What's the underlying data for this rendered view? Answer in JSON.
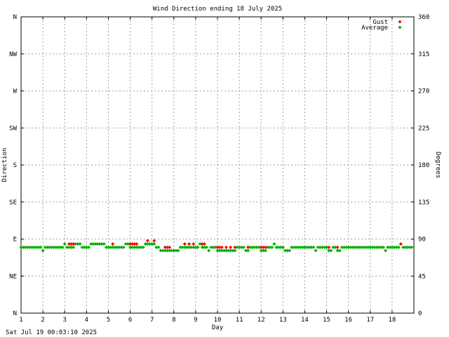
{
  "chart_data": {
    "type": "scatter",
    "title": "Wind Direction ending 18 July 2025",
    "xlabel": "Day",
    "ylabel_left": "Direction",
    "ylabel_right": "Degrees",
    "xlim": [
      1,
      19
    ],
    "ylim": [
      0,
      360
    ],
    "x_ticks": [
      1,
      2,
      3,
      4,
      5,
      6,
      7,
      8,
      9,
      10,
      11,
      12,
      13,
      14,
      15,
      16,
      17,
      18
    ],
    "y_ticks_left": [
      {
        "value": 0,
        "label": "N"
      },
      {
        "value": 45,
        "label": "NE"
      },
      {
        "value": 90,
        "label": "E"
      },
      {
        "value": 135,
        "label": "SE"
      },
      {
        "value": 180,
        "label": "S"
      },
      {
        "value": 225,
        "label": "SW"
      },
      {
        "value": 270,
        "label": "W"
      },
      {
        "value": 315,
        "label": "NW"
      },
      {
        "value": 360,
        "label": "N"
      }
    ],
    "y_ticks_right": [
      0,
      45,
      90,
      135,
      180,
      225,
      270,
      315,
      360
    ],
    "grid": true,
    "legend_position": "top-right",
    "series": [
      {
        "name": "Gust",
        "color": "#ff0000",
        "points": [
          [
            3.2,
            84
          ],
          [
            3.3,
            84
          ],
          [
            3.4,
            84
          ],
          [
            5.2,
            84
          ],
          [
            6.0,
            84
          ],
          [
            6.1,
            84
          ],
          [
            6.2,
            84
          ],
          [
            6.3,
            84
          ],
          [
            6.8,
            88
          ],
          [
            7.1,
            88
          ],
          [
            7.6,
            80
          ],
          [
            7.7,
            80
          ],
          [
            7.8,
            80
          ],
          [
            8.5,
            84
          ],
          [
            8.7,
            84
          ],
          [
            8.9,
            84
          ],
          [
            9.3,
            84
          ],
          [
            9.4,
            84
          ],
          [
            10.0,
            80
          ],
          [
            10.1,
            80
          ],
          [
            10.2,
            80
          ],
          [
            10.4,
            80
          ],
          [
            10.6,
            80
          ],
          [
            10.8,
            80
          ],
          [
            11.4,
            80
          ],
          [
            12.0,
            80
          ],
          [
            12.1,
            80
          ],
          [
            12.2,
            80
          ],
          [
            15.1,
            80
          ],
          [
            15.5,
            80
          ],
          [
            18.4,
            84
          ]
        ]
      },
      {
        "name": "Average",
        "color": "#00b000",
        "points": [
          [
            1.0,
            80
          ],
          [
            1.1,
            80
          ],
          [
            1.2,
            80
          ],
          [
            1.3,
            80
          ],
          [
            1.4,
            80
          ],
          [
            1.5,
            80
          ],
          [
            1.6,
            80
          ],
          [
            1.7,
            80
          ],
          [
            1.8,
            80
          ],
          [
            1.9,
            80
          ],
          [
            2.0,
            76
          ],
          [
            2.1,
            80
          ],
          [
            2.2,
            80
          ],
          [
            2.3,
            80
          ],
          [
            2.4,
            80
          ],
          [
            2.5,
            80
          ],
          [
            2.6,
            80
          ],
          [
            2.7,
            80
          ],
          [
            2.8,
            80
          ],
          [
            2.9,
            80
          ],
          [
            3.0,
            84
          ],
          [
            3.1,
            80
          ],
          [
            3.2,
            80
          ],
          [
            3.3,
            80
          ],
          [
            3.4,
            80
          ],
          [
            3.5,
            84
          ],
          [
            3.6,
            84
          ],
          [
            3.7,
            84
          ],
          [
            3.8,
            80
          ],
          [
            3.9,
            80
          ],
          [
            4.0,
            80
          ],
          [
            4.1,
            80
          ],
          [
            4.2,
            84
          ],
          [
            4.3,
            84
          ],
          [
            4.4,
            84
          ],
          [
            4.5,
            84
          ],
          [
            4.6,
            84
          ],
          [
            4.7,
            84
          ],
          [
            4.8,
            84
          ],
          [
            4.9,
            80
          ],
          [
            5.0,
            80
          ],
          [
            5.1,
            80
          ],
          [
            5.2,
            80
          ],
          [
            5.3,
            80
          ],
          [
            5.4,
            80
          ],
          [
            5.5,
            80
          ],
          [
            5.6,
            80
          ],
          [
            5.7,
            80
          ],
          [
            5.8,
            84
          ],
          [
            5.9,
            84
          ],
          [
            6.0,
            80
          ],
          [
            6.1,
            80
          ],
          [
            6.2,
            80
          ],
          [
            6.3,
            80
          ],
          [
            6.4,
            80
          ],
          [
            6.5,
            80
          ],
          [
            6.6,
            80
          ],
          [
            6.7,
            84
          ],
          [
            6.8,
            84
          ],
          [
            6.9,
            84
          ],
          [
            7.0,
            84
          ],
          [
            7.1,
            84
          ],
          [
            7.2,
            80
          ],
          [
            7.3,
            80
          ],
          [
            7.4,
            76
          ],
          [
            7.5,
            76
          ],
          [
            7.6,
            76
          ],
          [
            7.7,
            76
          ],
          [
            7.8,
            76
          ],
          [
            7.9,
            76
          ],
          [
            8.0,
            76
          ],
          [
            8.1,
            76
          ],
          [
            8.2,
            76
          ],
          [
            8.3,
            80
          ],
          [
            8.4,
            80
          ],
          [
            8.5,
            80
          ],
          [
            8.6,
            80
          ],
          [
            8.7,
            80
          ],
          [
            8.8,
            80
          ],
          [
            8.9,
            80
          ],
          [
            9.0,
            80
          ],
          [
            9.1,
            80
          ],
          [
            9.2,
            84
          ],
          [
            9.3,
            80
          ],
          [
            9.4,
            80
          ],
          [
            9.5,
            80
          ],
          [
            9.6,
            76
          ],
          [
            9.7,
            80
          ],
          [
            9.8,
            80
          ],
          [
            9.9,
            80
          ],
          [
            10.0,
            76
          ],
          [
            10.1,
            76
          ],
          [
            10.2,
            76
          ],
          [
            10.3,
            76
          ],
          [
            10.4,
            76
          ],
          [
            10.5,
            76
          ],
          [
            10.6,
            76
          ],
          [
            10.7,
            76
          ],
          [
            10.8,
            76
          ],
          [
            10.9,
            80
          ],
          [
            11.0,
            80
          ],
          [
            11.1,
            80
          ],
          [
            11.2,
            80
          ],
          [
            11.3,
            76
          ],
          [
            11.4,
            76
          ],
          [
            11.5,
            80
          ],
          [
            11.6,
            80
          ],
          [
            11.7,
            80
          ],
          [
            11.8,
            80
          ],
          [
            11.9,
            80
          ],
          [
            12.0,
            76
          ],
          [
            12.1,
            76
          ],
          [
            12.2,
            76
          ],
          [
            12.3,
            80
          ],
          [
            12.4,
            80
          ],
          [
            12.5,
            80
          ],
          [
            12.6,
            84
          ],
          [
            12.7,
            80
          ],
          [
            12.8,
            80
          ],
          [
            12.9,
            80
          ],
          [
            13.0,
            80
          ],
          [
            13.1,
            76
          ],
          [
            13.2,
            76
          ],
          [
            13.3,
            76
          ],
          [
            13.4,
            80
          ],
          [
            13.5,
            80
          ],
          [
            13.6,
            80
          ],
          [
            13.7,
            80
          ],
          [
            13.8,
            80
          ],
          [
            13.9,
            80
          ],
          [
            14.0,
            80
          ],
          [
            14.1,
            80
          ],
          [
            14.2,
            80
          ],
          [
            14.3,
            80
          ],
          [
            14.4,
            80
          ],
          [
            14.5,
            76
          ],
          [
            14.6,
            80
          ],
          [
            14.7,
            80
          ],
          [
            14.8,
            80
          ],
          [
            14.9,
            80
          ],
          [
            15.0,
            80
          ],
          [
            15.1,
            76
          ],
          [
            15.2,
            76
          ],
          [
            15.3,
            80
          ],
          [
            15.4,
            80
          ],
          [
            15.5,
            76
          ],
          [
            15.6,
            76
          ],
          [
            15.7,
            80
          ],
          [
            15.8,
            80
          ],
          [
            15.9,
            80
          ],
          [
            16.0,
            80
          ],
          [
            16.1,
            80
          ],
          [
            16.2,
            80
          ],
          [
            16.3,
            80
          ],
          [
            16.4,
            80
          ],
          [
            16.5,
            80
          ],
          [
            16.6,
            80
          ],
          [
            16.7,
            80
          ],
          [
            16.8,
            80
          ],
          [
            16.9,
            80
          ],
          [
            17.0,
            80
          ],
          [
            17.1,
            80
          ],
          [
            17.2,
            80
          ],
          [
            17.3,
            80
          ],
          [
            17.4,
            80
          ],
          [
            17.5,
            80
          ],
          [
            17.6,
            80
          ],
          [
            17.7,
            76
          ],
          [
            17.8,
            80
          ],
          [
            17.9,
            80
          ],
          [
            18.0,
            80
          ],
          [
            18.1,
            80
          ],
          [
            18.2,
            80
          ],
          [
            18.3,
            80
          ],
          [
            18.4,
            84
          ],
          [
            18.5,
            80
          ],
          [
            18.6,
            80
          ],
          [
            18.7,
            80
          ],
          [
            18.8,
            80
          ],
          [
            18.9,
            80
          ]
        ]
      }
    ]
  },
  "footer": {
    "timestamp": "Sat Jul 19 00:03:10 2025"
  }
}
